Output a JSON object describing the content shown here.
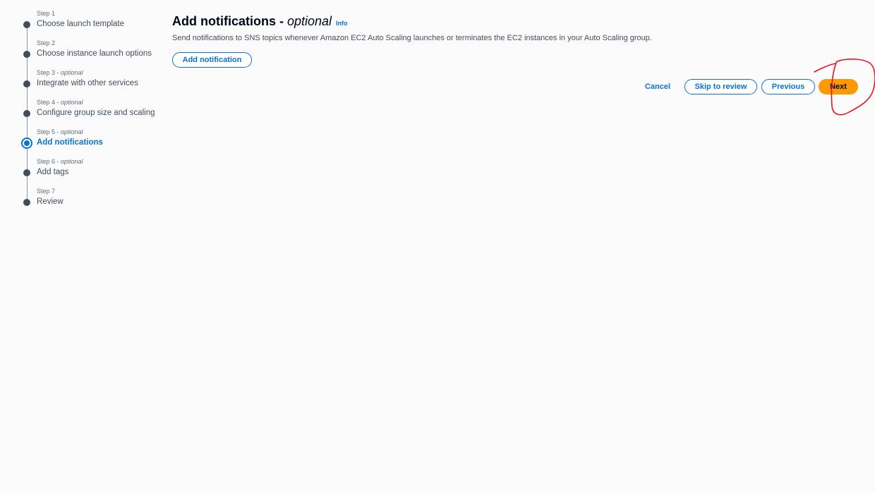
{
  "steps": [
    {
      "step": "Step 1",
      "optional": "",
      "name": "Choose launch template",
      "active": false
    },
    {
      "step": "Step 2",
      "optional": "",
      "name": "Choose instance launch options",
      "active": false
    },
    {
      "step": "Step 3",
      "optional": "optional",
      "name": "Integrate with other services",
      "active": false
    },
    {
      "step": "Step 4",
      "optional": "optional",
      "name": "Configure group size and scaling",
      "active": false
    },
    {
      "step": "Step 5",
      "optional": "optional",
      "name": "Add notifications",
      "active": true
    },
    {
      "step": "Step 6",
      "optional": "optional",
      "name": "Add tags",
      "active": false
    },
    {
      "step": "Step 7",
      "optional": "",
      "name": "Review",
      "active": false
    }
  ],
  "header": {
    "title": "Add notifications -",
    "title_optional": "optional",
    "info": "Info",
    "description": "Send notifications to SNS topics whenever Amazon EC2 Auto Scaling launches or terminates the EC2 instances in your Auto Scaling group."
  },
  "actions": {
    "add_notification": "Add notification",
    "cancel": "Cancel",
    "skip_to_review": "Skip to review",
    "previous": "Previous",
    "next": "Next"
  },
  "colors": {
    "accent": "#0972d3",
    "primary_button": "#ff9900",
    "annotation": "#e8141e"
  }
}
